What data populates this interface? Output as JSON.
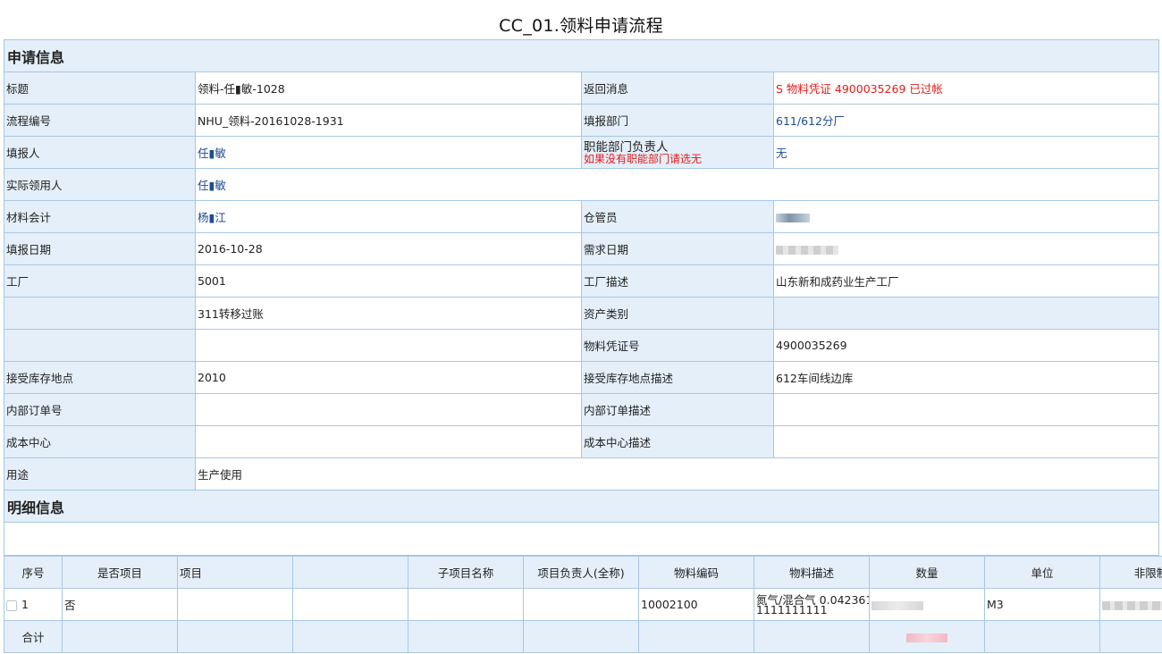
{
  "page_title": "CC_01.领料申请流程",
  "section_apply": "申请信息",
  "section_detail": "明细信息",
  "fields": {
    "title_label": "标题",
    "title_value": "领料-任▮敏-1028",
    "return_msg_label": "返回消息",
    "return_msg_value": "S 物料凭证 4900035269 已过帐",
    "flow_no_label": "流程编号",
    "flow_no_value": "NHU_领料-20161028-1931",
    "dept_label": "填报部门",
    "dept_value": "611/612分厂",
    "reporter_label": "填报人",
    "reporter_value": "任▮敏",
    "func_head_label": "职能部门负责人",
    "func_head_hint": "如果没有职能部门请选无",
    "func_head_value": "无",
    "actual_user_label": "实际领用人",
    "actual_user_value": "任▮敏",
    "accountant_label": "材料会计",
    "accountant_value": "杨▮江",
    "keeper_label": "仓管员",
    "date_label": "填报日期",
    "date_value": "2016-10-28",
    "need_date_label": "需求日期",
    "factory_label": "工厂",
    "factory_value": "5001",
    "factory_desc_label": "工厂描述",
    "factory_desc_value": "山东新和成药业生产工厂",
    "move_type_value": "311转移过账",
    "asset_type_label": "资产类别",
    "doc_no_label": "物料凭证号",
    "doc_no_value": "4900035269",
    "storage_label": "接受库存地点",
    "storage_value": "2010",
    "storage_desc_label": "接受库存地点描述",
    "storage_desc_value": "612车间线边库",
    "inner_order_label": "内部订单号",
    "inner_order_desc_label": "内部订单描述",
    "cost_center_label": "成本中心",
    "cost_center_desc_label": "成本中心描述",
    "usage_label": "用途",
    "usage_value": "生产使用"
  },
  "detail": {
    "headers": [
      "序号",
      "是否项目",
      "项目",
      "",
      "子项目名称",
      "项目负责人(全称)",
      "物料编码",
      "物料描述",
      "数量",
      "单位",
      "非限制"
    ],
    "row": {
      "index": "1",
      "is_project": "否",
      "material_code": "10002100",
      "material_desc_line1": "氮气/混合气 0.042361",
      "material_desc_line2": "1111111111",
      "unit": "M3"
    },
    "total_label": "合计"
  },
  "colors": {
    "label_bg": "#e4eff9",
    "border": "#a7c8e6",
    "link": "#1e4c8f",
    "alert": "#e41b1b"
  }
}
